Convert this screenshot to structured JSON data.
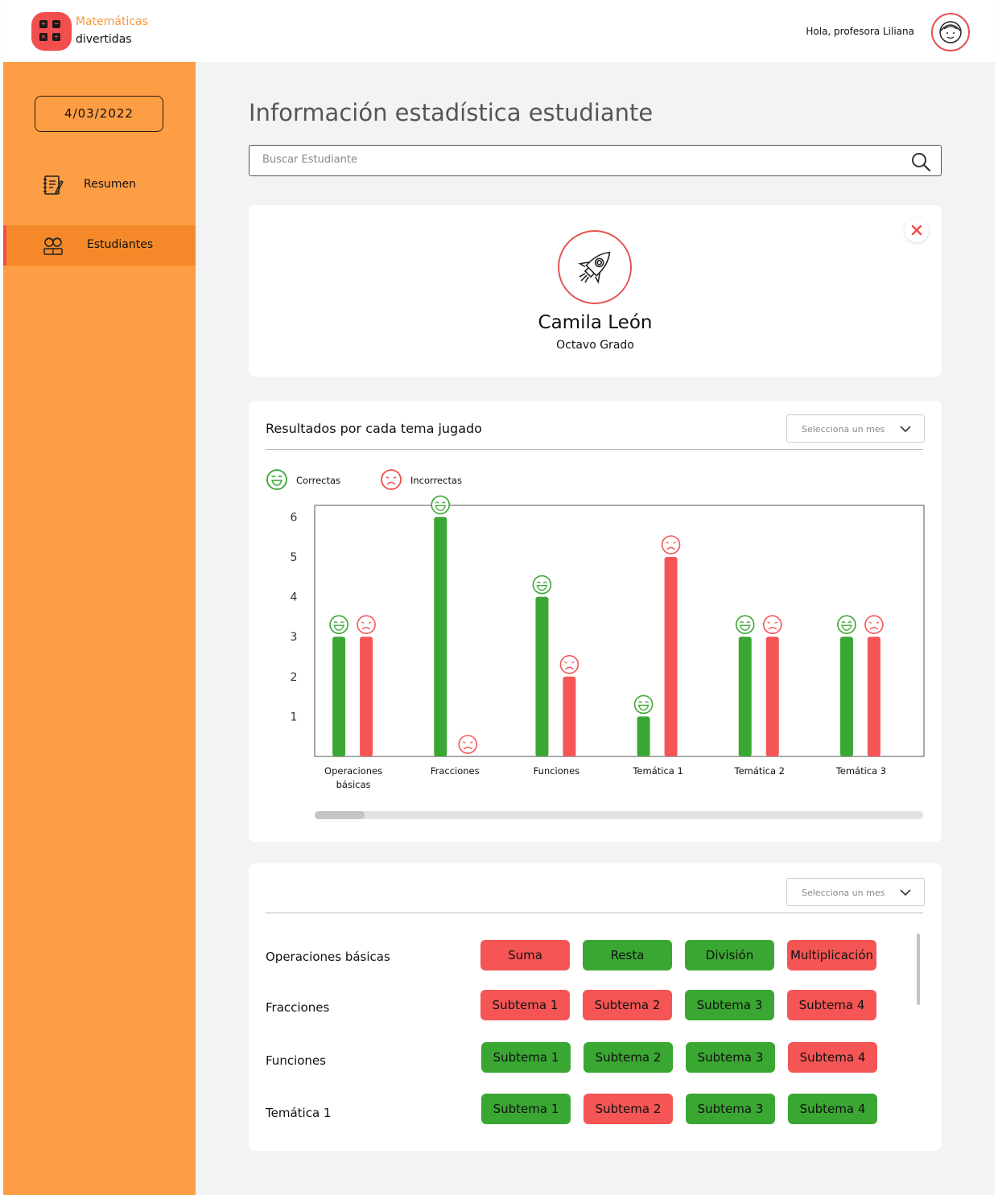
{
  "header": {
    "brand_line1": "Matemáticas",
    "brand_line2": "divertidas",
    "greeting": "Hola, profesora Liliana",
    "logo_icon": "calculator-icon",
    "avatar_icon": "teacher-avatar-icon"
  },
  "sidebar": {
    "date": "4/03/2022",
    "items": [
      {
        "label": "Resumen",
        "icon": "notebook-icon",
        "active": false
      },
      {
        "label": "Estudiantes",
        "icon": "students-icon",
        "active": true
      }
    ]
  },
  "main": {
    "title": "Información estadística estudiante",
    "search_placeholder": "Buscar Estudiante"
  },
  "student": {
    "name": "Camila León",
    "grade": "Octavo Grado",
    "avatar_icon": "rocket-icon"
  },
  "results": {
    "title": "Resultados por cada tema jugado",
    "month_select_placeholder": "Selecciona un mes",
    "legend_correct": "Correctas",
    "legend_incorrect": "Incorrectas"
  },
  "chart_data": {
    "type": "bar",
    "categories": [
      "Operaciones básicas",
      "Fracciones",
      "Funciones",
      "Temática 1",
      "Temática 2",
      "Temática 3"
    ],
    "category_lines": [
      [
        "Operaciones",
        "básicas"
      ],
      [
        "Fracciones"
      ],
      [
        "Funciones"
      ],
      [
        "Temática 1"
      ],
      [
        "Temática 2"
      ],
      [
        "Temática 3"
      ]
    ],
    "series": [
      {
        "name": "Correctas",
        "values": [
          3,
          6,
          4,
          1,
          3,
          3
        ],
        "color": "#3aa733",
        "icon": "happy-face-icon"
      },
      {
        "name": "Incorrectas",
        "values": [
          3,
          0,
          2,
          5,
          3,
          3
        ],
        "color": "#f55555",
        "icon": "sad-face-icon"
      }
    ],
    "yticks": [
      1,
      2,
      3,
      4,
      5,
      6
    ],
    "ylim": [
      0,
      6.5
    ]
  },
  "topics": {
    "month_select_placeholder": "Selecciona un mes",
    "rows": [
      {
        "name": "Operaciones básicas",
        "chips": [
          {
            "label": "Suma",
            "status": "bad"
          },
          {
            "label": "Resta",
            "status": "ok"
          },
          {
            "label": "División",
            "status": "ok"
          },
          {
            "label": "Multiplicación",
            "status": "bad"
          }
        ]
      },
      {
        "name": "Fracciones",
        "chips": [
          {
            "label": "Subtema 1",
            "status": "bad"
          },
          {
            "label": "Subtema 2",
            "status": "bad"
          },
          {
            "label": "Subtema 3",
            "status": "ok"
          },
          {
            "label": "Subtema 4",
            "status": "bad"
          }
        ]
      },
      {
        "name": "Funciones",
        "chips": [
          {
            "label": "Subtema 1",
            "status": "ok"
          },
          {
            "label": "Subtema 2",
            "status": "ok"
          },
          {
            "label": "Subtema 3",
            "status": "ok"
          },
          {
            "label": "Subtema 4",
            "status": "bad"
          }
        ]
      },
      {
        "name": "Temática 1",
        "chips": [
          {
            "label": "Subtema 1",
            "status": "ok"
          },
          {
            "label": "Subtema 2",
            "status": "bad"
          },
          {
            "label": "Subtema 3",
            "status": "ok"
          },
          {
            "label": "Subtema 4",
            "status": "ok"
          }
        ]
      }
    ]
  },
  "colors": {
    "sidebar": "#fe9e44",
    "sidebar_active": "#f5892a",
    "correct": "#3aa733",
    "incorrect": "#f55555",
    "accent": "#f24e4e"
  }
}
